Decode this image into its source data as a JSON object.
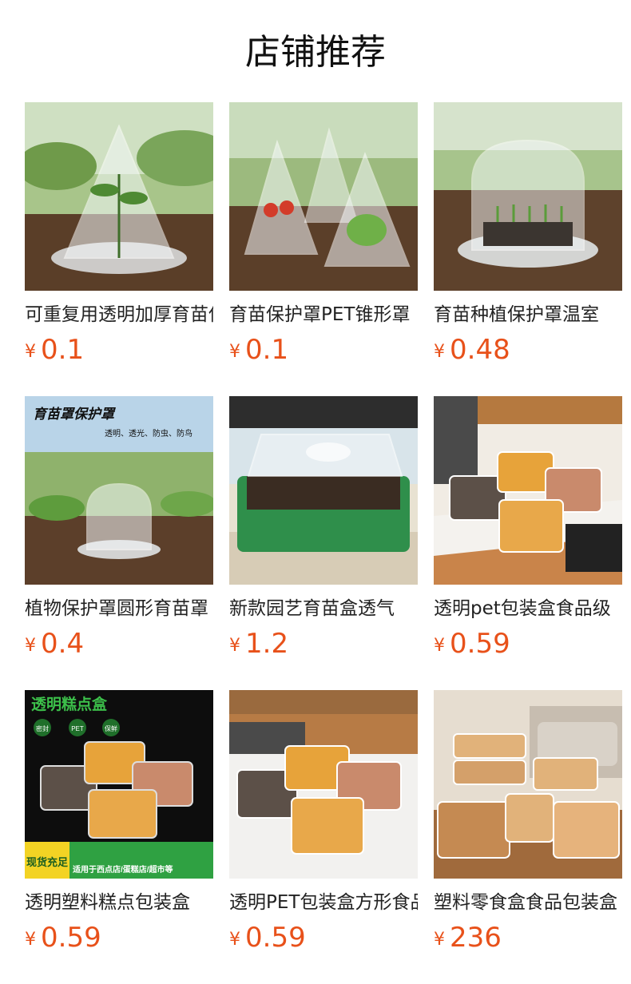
{
  "section_title": "店铺推荐",
  "currency_symbol": "¥",
  "accent_color": "#e8511a",
  "products": [
    {
      "name": "可重复用透明加厚育苗保护罩",
      "price": "0.1",
      "image": "cone-cover-seedling-photo",
      "overlay": {}
    },
    {
      "name": "育苗保护罩PET锥形罩",
      "price": "0.1",
      "image": "three-cone-covers-photo",
      "overlay": {}
    },
    {
      "name": "育苗种植保护罩温室",
      "price": "0.48",
      "image": "dome-cover-tray-photo",
      "overlay": {}
    },
    {
      "name": "植物保护罩圆形育苗罩",
      "price": "0.4",
      "image": "dome-cover-garden-photo",
      "overlay": {
        "heading": "育苗罩保护罩",
        "sub": "透明、透光、防虫、防鸟"
      }
    },
    {
      "name": "新款园艺育苗盒透气",
      "price": "1.2",
      "image": "green-seedling-tray-photo",
      "overlay": {}
    },
    {
      "name": "透明pet包装盒食品级",
      "price": "0.59",
      "image": "pastry-boxes-kitchen-photo",
      "overlay": {}
    },
    {
      "name": "透明塑料糕点包装盒",
      "price": "0.59",
      "image": "pastry-boxes-ad-photo",
      "overlay": {
        "heading": "透明糕点盒",
        "badge1": "密封",
        "badge2": "PET",
        "badge3": "保鲜",
        "stock": "现货充足",
        "usage": "适用于西点店/蛋糕店/超市等"
      }
    },
    {
      "name": "透明PET包装盒方形食品盒",
      "price": "0.59",
      "image": "pastry-boxes-counter-photo",
      "overlay": {}
    },
    {
      "name": "塑料零食盒食品包装盒",
      "price": "236",
      "image": "snack-boxes-livingroom-photo",
      "overlay": {}
    }
  ]
}
